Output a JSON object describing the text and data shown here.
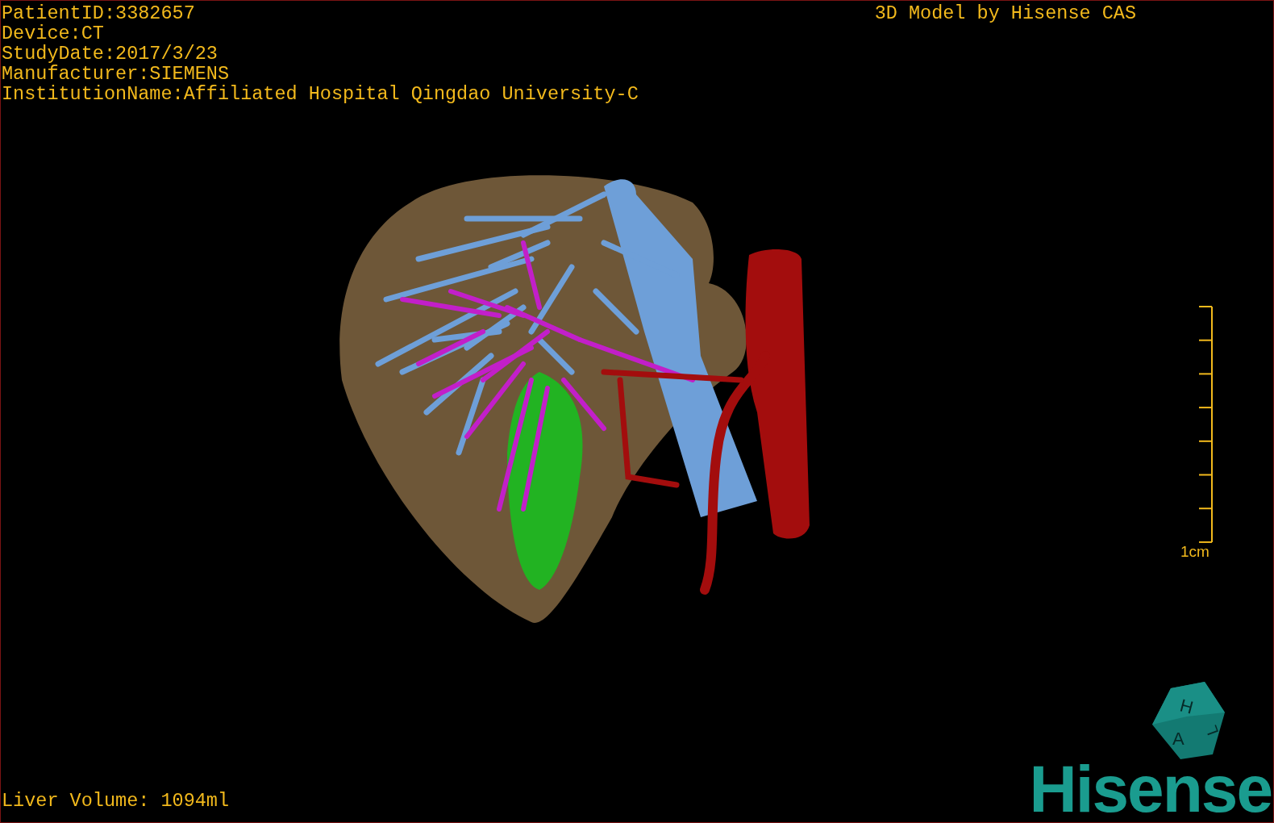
{
  "info_lines": [
    "PatientID:3382657",
    "Device:CT",
    "StudyDate:2017/3/23",
    "Manufacturer:SIEMENS",
    "InstitutionName:Affiliated Hospital Qingdao University-C"
  ],
  "title": "3D Model by Hisense CAS",
  "scale_bar": {
    "label": "1cm"
  },
  "orientation_cube": {
    "letters": [
      "H",
      "A",
      "L"
    ]
  },
  "liver_volume": "Liver Volume: 1094ml",
  "logo": "Hisense"
}
